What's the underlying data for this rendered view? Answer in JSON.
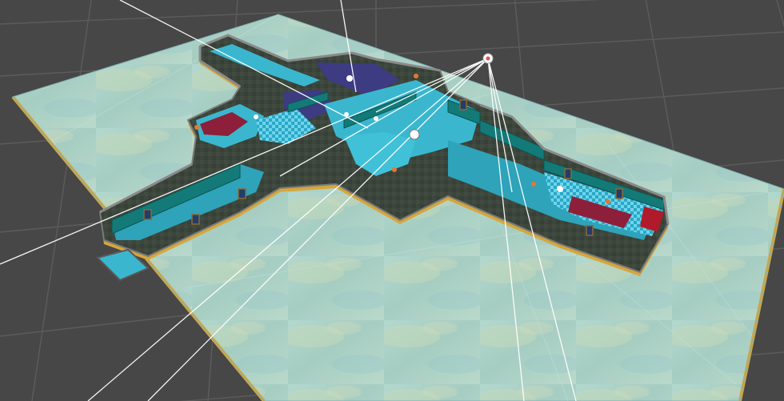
{
  "scene": {
    "background_color": "#474747",
    "grid_color": "#5a5a5a",
    "ground_color": "#a9d0c6",
    "ground_edge_color": "#d6a63a",
    "wall_color": "#3d4a3e",
    "wall_top_color": "#6c6c6c",
    "floor_color": "#3ab7cf",
    "interior_wall_color": "#137a78",
    "accent_rug_color": "#8e1f3a",
    "carpet_color": "#3a3a7a",
    "light_gizmo_color": "#ffffff",
    "selected_object": "point-light",
    "rooms": [
      "northwest-corridor",
      "dining-room-west",
      "central-hall",
      "purple-carpet-room",
      "south-corridor",
      "entrance-hall",
      "east-wing",
      "red-bed-room"
    ]
  }
}
